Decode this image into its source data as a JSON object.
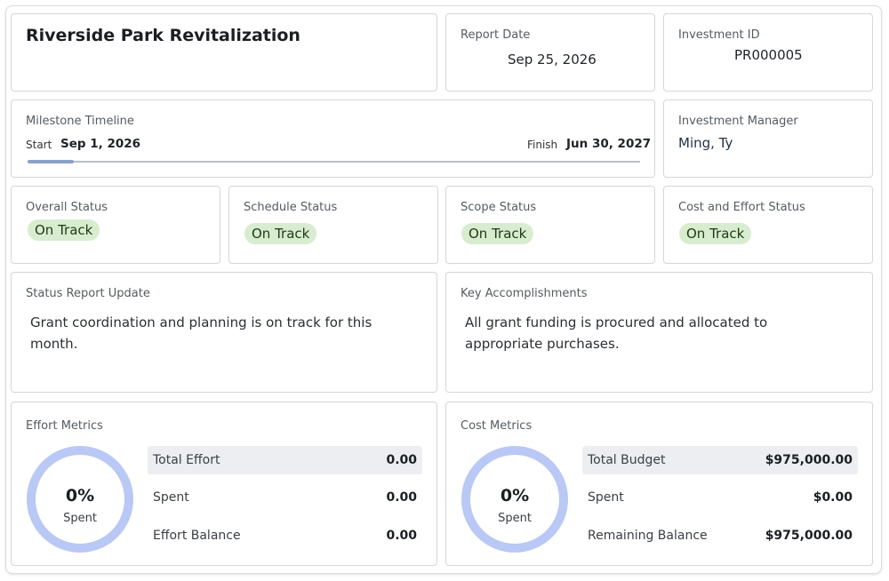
{
  "header": {
    "project_title": "Riverside Park Revitalization",
    "report_date_label": "Report Date",
    "report_date": "Sep 25, 2026",
    "investment_id_label": "Investment ID",
    "investment_id": "PR000005"
  },
  "timeline": {
    "label": "Milestone Timeline",
    "start_label": "Start",
    "start_date": "Sep 1, 2026",
    "finish_label": "Finish",
    "finish_date": "Jun 30, 2027",
    "progress_fraction": 0.075
  },
  "manager": {
    "label": "Investment Manager",
    "name": "Ming, Ty"
  },
  "statuses": [
    {
      "label": "Overall Status",
      "value": "On Track"
    },
    {
      "label": "Schedule Status",
      "value": "On Track"
    },
    {
      "label": "Scope Status",
      "value": "On Track"
    },
    {
      "label": "Cost and Effort Status",
      "value": "On Track"
    }
  ],
  "status_update": {
    "label": "Status Report Update",
    "text": "Grant coordination and planning is on track for this month."
  },
  "accomplishments": {
    "label": "Key Accomplishments",
    "text": "All grant funding is procured and allocated to appropriate purchases."
  },
  "effort_metrics": {
    "label": "Effort Metrics",
    "percent": "0%",
    "percent_caption": "Spent",
    "percent_value": 0,
    "rows": [
      {
        "label": "Total Effort",
        "value": "0.00"
      },
      {
        "label": "Spent",
        "value": "0.00"
      },
      {
        "label": "Effort Balance",
        "value": "0.00"
      }
    ]
  },
  "cost_metrics": {
    "label": "Cost Metrics",
    "percent": "0%",
    "percent_caption": "Spent",
    "percent_value": 0,
    "rows": [
      {
        "label": "Total Budget",
        "value": "$975,000.00"
      },
      {
        "label": "Spent",
        "value": "$0.00"
      },
      {
        "label": "Remaining Balance",
        "value": "$975,000.00"
      }
    ]
  },
  "colors": {
    "pill_bg": "#d8ecd0",
    "donut_ring": "#b9c8f4",
    "progress_fill": "#8aa0c8"
  }
}
